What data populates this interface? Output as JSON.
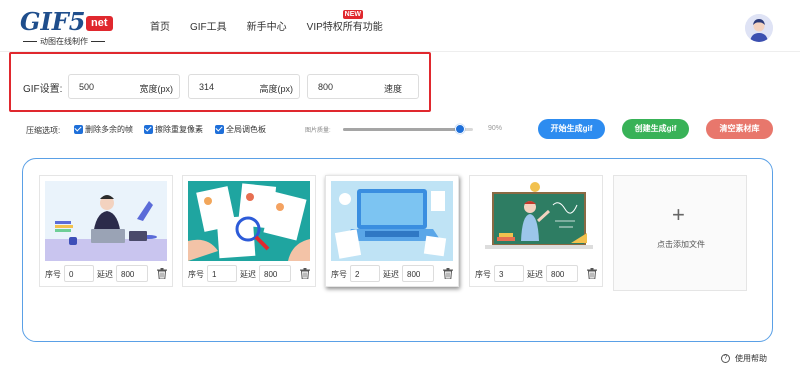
{
  "header": {
    "logo_text": "GIF5.",
    "logo_badge": "net",
    "logo_subtitle": "动图在线制作",
    "nav": [
      {
        "label": "首页"
      },
      {
        "label": "GIF工具"
      },
      {
        "label": "新手中心"
      },
      {
        "label": "VIP特权",
        "badge": "NEW"
      },
      {
        "label": "所有功能"
      }
    ]
  },
  "settings": {
    "label": "GIF设置:",
    "width": {
      "value": "500",
      "unit": "宽度(px)"
    },
    "height": {
      "value": "314",
      "unit": "高度(px)"
    },
    "speed": {
      "value": "800",
      "unit": "速度"
    }
  },
  "options": {
    "label": "压缩选项:",
    "checkboxes": [
      {
        "label": "删除多余的帧",
        "checked": true
      },
      {
        "label": "擦除重复像素",
        "checked": true
      },
      {
        "label": "全局调色板",
        "checked": true
      }
    ],
    "quality_label": "图片质量:",
    "quality_value": "90%",
    "quality_fraction": 0.9
  },
  "buttons": {
    "start": "开始生成gif",
    "create": "创建生成gif",
    "clear": "清空素材库"
  },
  "frames": [
    {
      "index_label": "序号",
      "index": "0",
      "delay_label": "延迟",
      "delay": "800",
      "image": "man-at-laptop-illustration"
    },
    {
      "index_label": "序号",
      "index": "1",
      "delay_label": "延迟",
      "delay": "800",
      "image": "resumes-magnifier-illustration"
    },
    {
      "index_label": "序号",
      "index": "2",
      "delay_label": "延迟",
      "delay": "800",
      "image": "laptop-desk-illustration"
    },
    {
      "index_label": "序号",
      "index": "3",
      "delay_label": "延迟",
      "delay": "800",
      "image": "teacher-chalkboard-illustration"
    }
  ],
  "add_file": {
    "plus": "+",
    "label": "点击添加文件"
  },
  "help": {
    "label": "使用帮助"
  },
  "colors": {
    "accent_blue": "#2d8cf0",
    "green": "#38b257",
    "salmon": "#e8776c",
    "highlight_red": "#e0282e",
    "checkbox_blue": "#1e6fd9"
  }
}
